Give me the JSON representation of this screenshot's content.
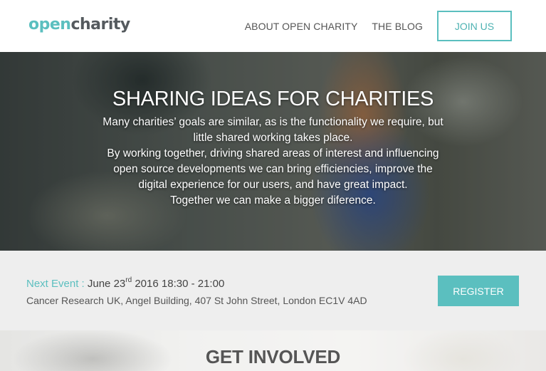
{
  "header": {
    "logo_part1": "open",
    "logo_part2": "charity",
    "nav": [
      {
        "label": "ABOUT OPEN CHARITY"
      },
      {
        "label": "THE BLOG"
      }
    ],
    "join_label": "JOIN US"
  },
  "hero": {
    "title": "SHARING IDEAS FOR CHARITIES",
    "lines": [
      "Many charities’ goals are similar, as is the functionality we require, but",
      "little shared working takes place.",
      "By working together, driving shared areas of interest and influencing",
      "open source developments we can bring efficiencies, improve the",
      "digital experience for our users, and have great impact.",
      "Together we can make a bigger diference."
    ]
  },
  "event": {
    "label": "Next Event :",
    "date_day": "June 23",
    "date_suffix": "rd",
    "date_rest": "2016 18:30 - 21:00",
    "address": "Cancer Research UK, Angel Building, 407 St John Street, London EC1V 4AD",
    "register_label": "REGISTER"
  },
  "involved": {
    "title": "GET INVOLVED"
  },
  "colors": {
    "accent": "#5bbfbf",
    "text_dark": "#555a5e",
    "event_bg": "#eeeeee"
  }
}
